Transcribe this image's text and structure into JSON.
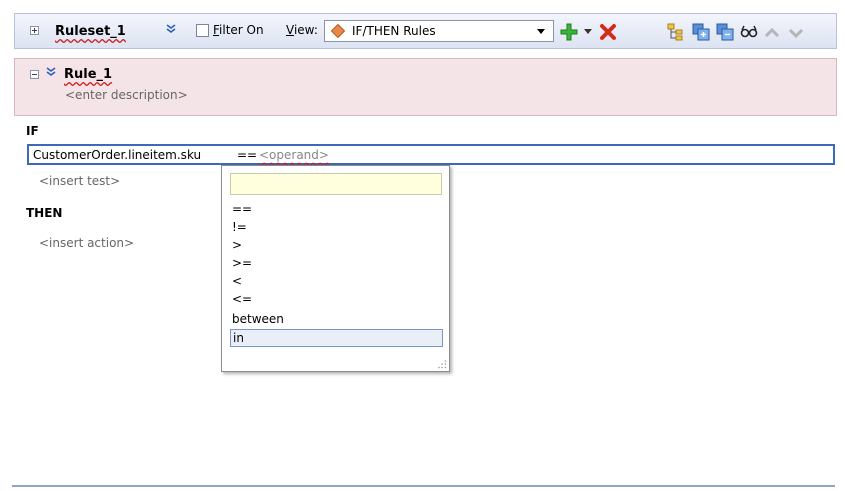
{
  "toolbar": {
    "ruleset_name": "Ruleset_1",
    "filter_label": "Filter On",
    "filter_checked": false,
    "view_label": "View:",
    "view_value": "IF/THEN Rules",
    "icons": [
      "expand-icon",
      "collapse-chevron-icon",
      "add-icon",
      "dropdown-arrow-icon",
      "delete-icon",
      "tree-icon",
      "expand-all-icon",
      "collapse-all-icon",
      "glasses-icon",
      "move-up-icon",
      "move-down-icon"
    ]
  },
  "rule": {
    "name": "Rule_1",
    "description": "<enter description>"
  },
  "if_label": "IF",
  "test": {
    "lhs": "CustomerOrder.lineitem.sku",
    "operator": "==",
    "rhs": "<operand>"
  },
  "insert_test": "<insert test>",
  "then_label": "THEN",
  "insert_action": "<insert action>",
  "operator_dropdown": {
    "filter_value": "",
    "options": [
      "==",
      "!=",
      ">",
      ">=",
      "<",
      "<=",
      "between",
      "in"
    ],
    "highlighted": "in"
  },
  "colors": {
    "toolbar_bg": "#dde3f2",
    "rule_bg": "#f4e4e8",
    "focus_border": "#3d69b8",
    "filter_bg": "#ffffdd"
  }
}
